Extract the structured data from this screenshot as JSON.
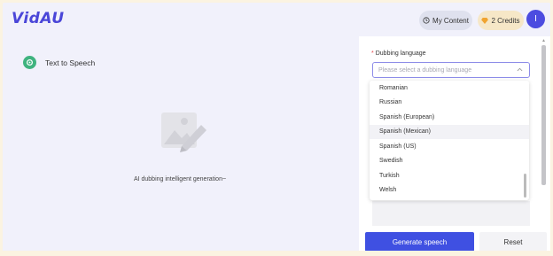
{
  "header": {
    "logo": "VidAU",
    "my_content_label": "My Content",
    "credits_label": "2 Credits",
    "avatar_initial": "I"
  },
  "left": {
    "feature_label": "Text to Speech",
    "generation_text": "AI dubbing intelligent generation~"
  },
  "form": {
    "required_mark": "*",
    "dubbing_label": "Dubbing language",
    "dubbing_placeholder": "Please select a dubbing language"
  },
  "dropdown": {
    "options": [
      "Romanian",
      "Russian",
      "Spanish (European)",
      "Spanish (Mexican)",
      "Spanish (US)",
      "Swedish",
      "Turkish",
      "Welsh"
    ],
    "hovered": "Spanish (Mexican)"
  },
  "actions": {
    "generate_label": "Generate speech",
    "reset_label": "Reset"
  },
  "colors": {
    "brand": "#4a46d8",
    "primary_button": "#3f50e2",
    "accent_green": "#3fb37f"
  }
}
